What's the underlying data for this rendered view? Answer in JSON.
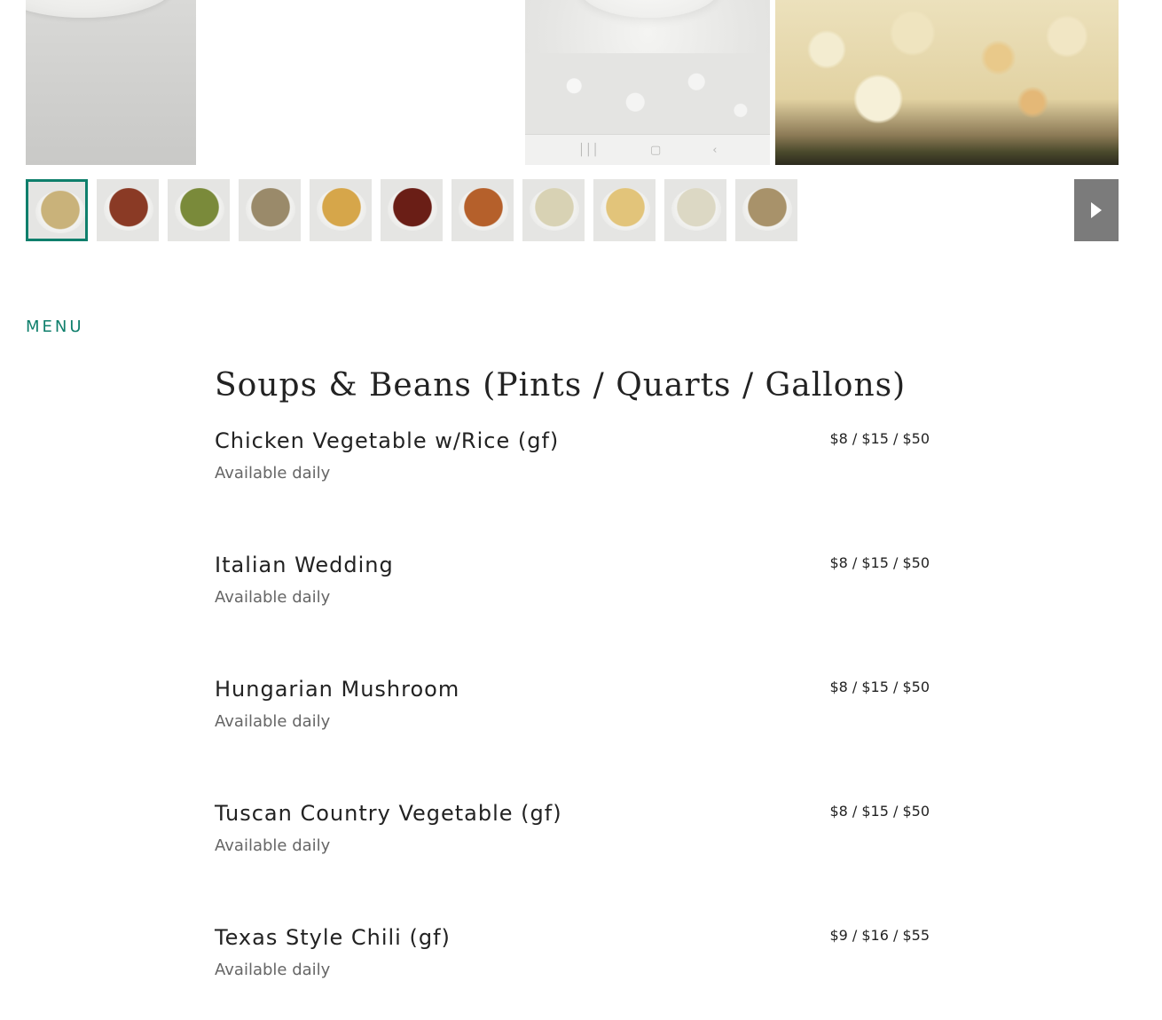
{
  "hero": {
    "images": [
      {
        "name": "plate-photo"
      },
      {
        "name": "bowl-photo"
      },
      {
        "name": "cheese-bread-photo"
      }
    ]
  },
  "thumbnails": [
    {
      "label": "cheese bread",
      "color": "#c9b27a",
      "active": true
    },
    {
      "label": "chili with bread",
      "color": "#8a3a25"
    },
    {
      "label": "vegetable soup",
      "color": "#7a8a3a"
    },
    {
      "label": "wedding soup",
      "color": "#9a8a6a"
    },
    {
      "label": "chicken curry soup",
      "color": "#d6a64a"
    },
    {
      "label": "chili with cheese",
      "color": "#6a1e16"
    },
    {
      "label": "tomato soup",
      "color": "#b5602b"
    },
    {
      "label": "cream soup",
      "color": "#d8d2b4"
    },
    {
      "label": "chicken noodle soup",
      "color": "#e2c47a"
    },
    {
      "label": "potato soup",
      "color": "#dcd8c4"
    },
    {
      "label": "mushroom soup",
      "color": "#a8926a"
    }
  ],
  "menu": {
    "label": "MENU",
    "section_title": "Soups & Beans (Pints / Quarts / Gallons)",
    "items": [
      {
        "name": "Chicken Vegetable w/Rice (gf)",
        "description": "Available daily",
        "price": "$8 / $15 / $50"
      },
      {
        "name": "Italian Wedding",
        "description": "Available daily",
        "price": "$8 / $15 / $50"
      },
      {
        "name": "Hungarian Mushroom",
        "description": "Available daily",
        "price": "$8 / $15 / $50"
      },
      {
        "name": "Tuscan Country Vegetable (gf)",
        "description": "Available daily",
        "price": "$8 / $15 / $50"
      },
      {
        "name": "Texas Style Chili (gf)",
        "description": "Available daily",
        "price": "$9 / $16 / $55"
      }
    ]
  },
  "colors": {
    "accent": "#0f7f6c",
    "next_button": "#7b7b7b"
  }
}
